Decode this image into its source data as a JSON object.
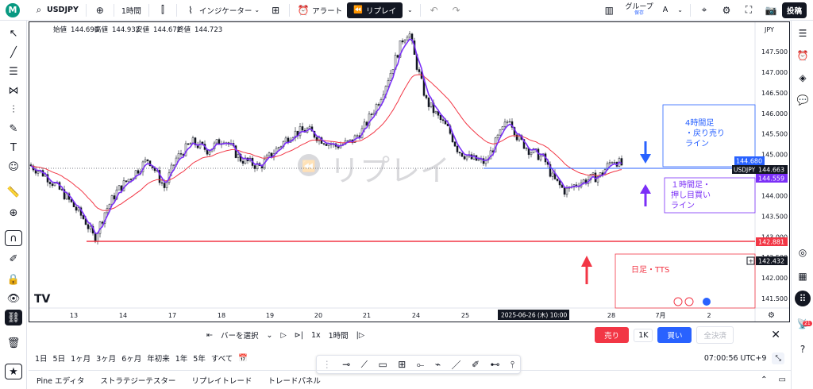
{
  "topbar": {
    "logo_letter": "M",
    "symbol": "USDJPY",
    "interval": "1時間",
    "indicators": "インジケーター",
    "alert": "アラート",
    "replay": "リプレイ",
    "group_label": "グループ",
    "group_sub": "保存",
    "group_letter": "A",
    "post": "投稿"
  },
  "chart": {
    "ohlc": {
      "open_label": "始値",
      "open": "144.690",
      "high_label": "高値",
      "high": "144.932",
      "low_label": "安値",
      "low": "144.672",
      "close_label": "終値",
      "close": "144.723"
    },
    "currency": "JPY",
    "price_ticks": [
      "147.500",
      "147.000",
      "146.500",
      "146.000",
      "145.500",
      "145.000",
      "144.500",
      "144.000",
      "143.500",
      "143.000",
      "142.500",
      "142.000",
      "141.500"
    ],
    "date_ticks": [
      "13",
      "14",
      "17",
      "18",
      "19",
      "20",
      "21",
      "24",
      "25",
      "28",
      "7月",
      "2"
    ],
    "cursor_date": "2025-06-26 (木)  10:00",
    "watermark": "リプレイ",
    "labels": {
      "box1_line1": "4時間足",
      "box1_line2": "・戻り売り",
      "box1_line3": "ライン",
      "box2_line1": "１時間足・",
      "box2_line2": "押し目買い",
      "box2_line3": "ライン",
      "tts": "日足・TTS"
    },
    "price_tags": {
      "blue_line": "144.680",
      "symbol_tag": "USDJPY",
      "last": "144.663",
      "purple": "144.559",
      "red_line": "142.881",
      "cursor_price": "142.432"
    },
    "colors": {
      "up": "#131722",
      "down": "#131722",
      "ema_fast": "#7b2ff7",
      "ema_slow": "#f23645",
      "blue": "#2962ff",
      "red": "#f23645"
    }
  },
  "bottom": {
    "bar_select": "バーを選択",
    "speed": "1x",
    "replay_interval": "1時間",
    "sell": "売り",
    "qty": "1K",
    "buy": "買い",
    "close_all": "全決済",
    "timeframes": [
      "1日",
      "5日",
      "1ヶ月",
      "3ヶ月",
      "6ヶ月",
      "年初来",
      "1年",
      "5年",
      "すべて"
    ],
    "clock": "07:00:56 UTC+9",
    "tabs": [
      "Pine エディタ",
      "ストラテジーテスター",
      "リプレイトレード",
      "トレードパネル"
    ]
  },
  "badge_count": "21"
}
